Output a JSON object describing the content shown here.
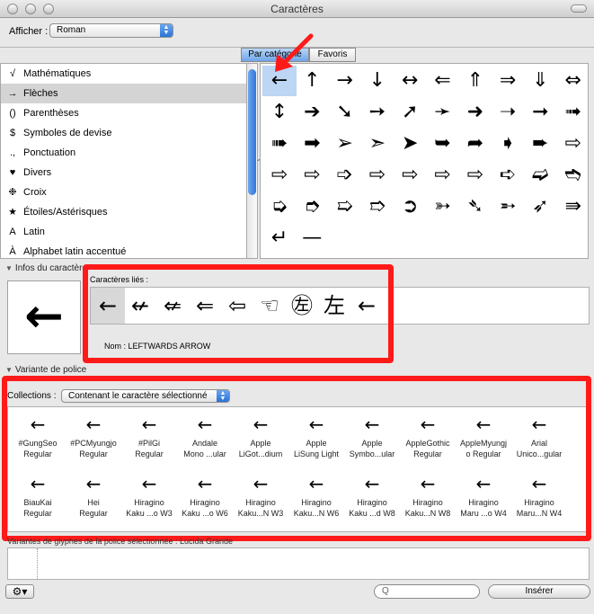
{
  "window": {
    "title": "Caractères"
  },
  "toolbar": {
    "afficher_label": "Afficher :",
    "afficher_value": "Roman"
  },
  "tabs": [
    {
      "label": "Par catégorie",
      "active": true
    },
    {
      "label": "Favoris",
      "active": false
    }
  ],
  "categories": [
    {
      "icon": "√",
      "label": "Mathématiques"
    },
    {
      "icon": "→",
      "label": "Flèches",
      "selected": true
    },
    {
      "icon": "()",
      "label": "Parenthèses"
    },
    {
      "icon": "$",
      "label": "Symboles de devise"
    },
    {
      "icon": ".,",
      "label": "Ponctuation"
    },
    {
      "icon": "♥",
      "label": "Divers"
    },
    {
      "icon": "❉",
      "label": "Croix"
    },
    {
      "icon": "★",
      "label": "Étoiles/Astérisques"
    },
    {
      "icon": "A",
      "label": "Latin"
    },
    {
      "icon": "À",
      "label": "Alphabet latin accentué"
    }
  ],
  "glyphs": [
    "←",
    "↑",
    "→",
    "↓",
    "↔",
    "⇐",
    "⇑",
    "⇒",
    "⇓",
    "⇔",
    "↕",
    "➔",
    "➘",
    "➙",
    "➚",
    "➛",
    "➜",
    "➝",
    "➞",
    "➟",
    "➠",
    "➡",
    "➢",
    "➣",
    "➤",
    "➥",
    "➦",
    "➧",
    "➨",
    "⇨",
    "⇨",
    "⇨",
    "➩",
    "⇨",
    "⇨",
    "⇨",
    "⇨",
    "➪",
    "➫",
    "➬",
    "➭",
    "➮",
    "➯",
    "➱",
    "➲",
    "➳",
    "➴",
    "➵",
    "➶",
    "⇛",
    "↵",
    "—"
  ],
  "selected_glyph": "←",
  "info": {
    "header": "Infos du caractère",
    "big_glyph": "←",
    "linked_label": "Caractères liés :",
    "linked": [
      "←",
      "↚",
      "⇍",
      "⇐",
      "⇦",
      "☜",
      "㊧",
      "左",
      "←"
    ],
    "name_label": "Nom :",
    "name_value": "LEFTWARDS ARROW"
  },
  "variant": {
    "header": "Variante de police",
    "collections_label": "Collections :",
    "collections_value": "Contenant le caractère sélectionné",
    "fonts": [
      {
        "glyph": "←",
        "line1": "#GungSeo",
        "line2": "Regular"
      },
      {
        "glyph": "←",
        "line1": "#PCMyungjo",
        "line2": "Regular"
      },
      {
        "glyph": "←",
        "line1": "#PilGi",
        "line2": "Regular"
      },
      {
        "glyph": "←",
        "line1": "Andale",
        "line2": "Mono ...ular"
      },
      {
        "glyph": "←",
        "line1": "Apple",
        "line2": "LiGot...dium"
      },
      {
        "glyph": "←",
        "line1": "Apple",
        "line2": "LiSung Light"
      },
      {
        "glyph": "←",
        "line1": "Apple",
        "line2": "Symbo...ular"
      },
      {
        "glyph": "←",
        "line1": "AppleGothic",
        "line2": "Regular"
      },
      {
        "glyph": "←",
        "line1": "AppleMyungj",
        "line2": "o Regular"
      },
      {
        "glyph": "←",
        "line1": "Arial",
        "line2": "Unico...gular"
      },
      {
        "glyph": "←",
        "line1": "BiauKai",
        "line2": "Regular"
      },
      {
        "glyph": "←",
        "line1": "Hei",
        "line2": "Regular"
      },
      {
        "glyph": "←",
        "line1": "Hiragino",
        "line2": "Kaku ...o W3"
      },
      {
        "glyph": "←",
        "line1": "Hiragino",
        "line2": "Kaku ...o W6"
      },
      {
        "glyph": "←",
        "line1": "Hiragino",
        "line2": "Kaku...N W3"
      },
      {
        "glyph": "←",
        "line1": "Hiragino",
        "line2": "Kaku...N W6"
      },
      {
        "glyph": "←",
        "line1": "Hiragino",
        "line2": "Kaku ...d W8"
      },
      {
        "glyph": "←",
        "line1": "Hiragino",
        "line2": "Kaku...N W8"
      },
      {
        "glyph": "←",
        "line1": "Hiragino",
        "line2": "Maru ...o W4"
      },
      {
        "glyph": "←",
        "line1": "Hiragino",
        "line2": "Maru...N W4"
      }
    ]
  },
  "glyph_variants": {
    "label": "Variantes de glyphes de la police sélectionnée :",
    "font": "Lucida Grande"
  },
  "bottom": {
    "gear": "⚙▾",
    "search_placeholder": "Q",
    "insert_label": "Insérer"
  },
  "colors": {
    "highlight": "#ff1a1a",
    "selection": "#bcd6f4",
    "scroll_thumb": "#2f76db"
  }
}
